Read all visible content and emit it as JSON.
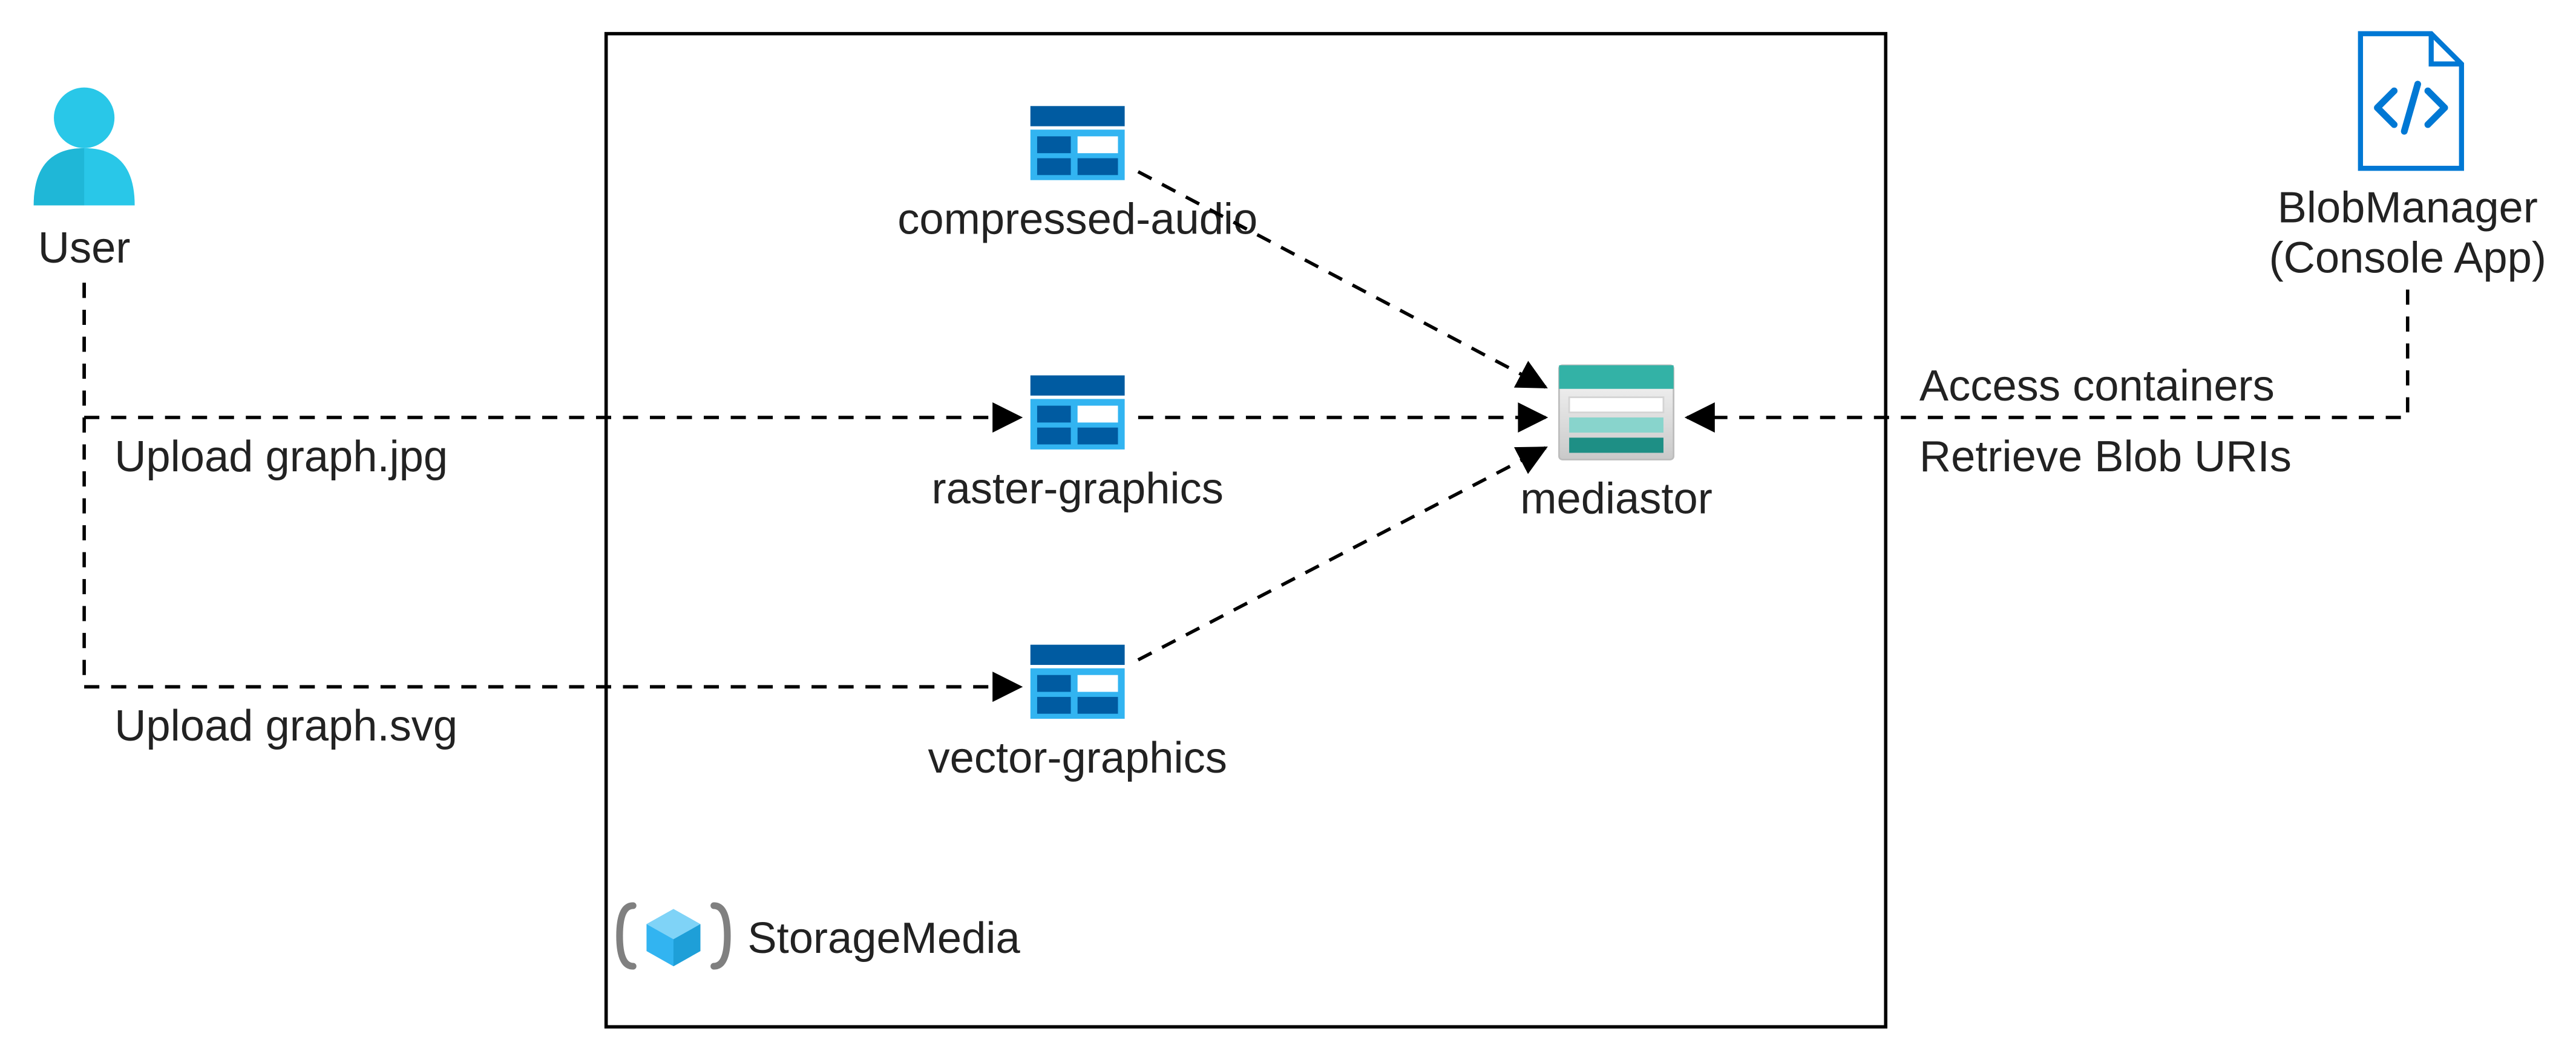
{
  "user": {
    "label": "User"
  },
  "blobmanager": {
    "line1": "BlobManager",
    "line2": "(Console App)"
  },
  "resourcegroup": {
    "label": "StorageMedia"
  },
  "containers": {
    "compressed_audio": "compressed-audio",
    "raster_graphics": "raster-graphics",
    "vector_graphics": "vector-graphics",
    "mediastor": "mediastor"
  },
  "edges": {
    "upload_jpg": "Upload graph.jpg",
    "upload_svg": "Upload graph.svg",
    "access_containers": "Access containers",
    "retrieve_blob_uris": "Retrieve Blob URIs"
  },
  "colors": {
    "azure_blue": "#0078D4",
    "container_dark": "#005BA1",
    "container_light": "#32B4F1",
    "teal": "#33B2A6",
    "teal_dark": "#1E8F85",
    "gray_light": "#E6E6E6",
    "user_cyan": "#29C7E8",
    "user_dark": "#0E9BB8"
  }
}
